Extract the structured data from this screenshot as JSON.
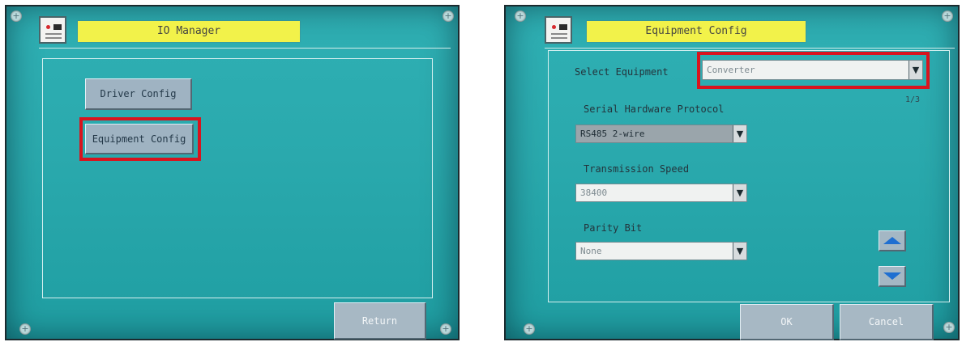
{
  "left": {
    "title": "IO Manager",
    "driver_config_label": "Driver Config",
    "equipment_config_label": "Equipment Config",
    "return_label": "Return"
  },
  "right": {
    "title": "Equipment Config",
    "select_equipment_label": "Select Equipment",
    "select_equipment_value": "Converter",
    "page_indicator": "1/3",
    "serial_protocol_label": "Serial Hardware Protocol",
    "serial_protocol_value": "RS485 2-wire",
    "transmission_speed_label": "Transmission Speed",
    "transmission_speed_value": "38400",
    "parity_bit_label": "Parity Bit",
    "parity_bit_value": "None",
    "ok_label": "OK",
    "cancel_label": "Cancel"
  },
  "icons": {
    "corner": "plus-screw-icon",
    "dropdown": "chevron-down-icon",
    "scroll_up": "arrow-up-icon",
    "scroll_down": "arrow-down-icon",
    "logo": "app-logo-icon"
  },
  "colors": {
    "screen_bg": "#2aa9ad",
    "title_bg": "#f2f24a",
    "highlight": "#d8141e",
    "arrow": "#1f6fd1"
  }
}
